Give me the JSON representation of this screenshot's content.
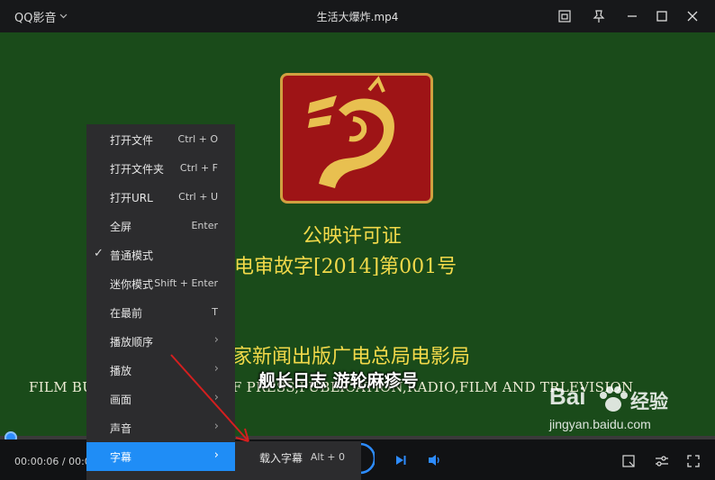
{
  "window": {
    "app_name": "QQ影音",
    "file_title": "生活大爆炸.mp4"
  },
  "video": {
    "certificate_title": "公映许可证",
    "certificate_number": "电审故字[2014]第001号",
    "bureau_cn": "家新闻出版广电总局电影局",
    "bureau_en": "FILM BU          STRATION OF PRESS,PUBLICATION,RADIO,FILM AND TRLEVISION",
    "subtitle": "舰长日志 游轮麻疹号"
  },
  "watermark": {
    "brand": "Bai",
    "brand_cn": "经验",
    "url": "jingyan.baidu.com"
  },
  "playback": {
    "time": "00:00:06 / 00:04",
    "progress_fraction": 0.01
  },
  "context_menu": {
    "items": [
      {
        "label": "打开文件",
        "shortcut": "Ctrl + O"
      },
      {
        "label": "打开文件夹",
        "shortcut": "Ctrl + F"
      },
      {
        "label": "打开URL",
        "shortcut": "Ctrl + U"
      },
      {
        "label": "全屏",
        "shortcut": "Enter"
      },
      {
        "label": "普通模式",
        "shortcut": "",
        "checked": true
      },
      {
        "label": "迷你模式",
        "shortcut": "Shift + Enter"
      },
      {
        "label": "在最前",
        "shortcut": "T"
      },
      {
        "label": "播放顺序",
        "submenu": true
      },
      {
        "label": "播放",
        "submenu": true
      },
      {
        "label": "画面",
        "submenu": true
      },
      {
        "label": "声音",
        "submenu": true
      },
      {
        "label": "字幕",
        "submenu": true,
        "active": true
      }
    ],
    "check_glyph": "✓",
    "arrow_glyph": "›"
  },
  "subtitle_submenu": {
    "items": [
      {
        "label": "载入字幕",
        "shortcut": "Alt + 0"
      }
    ]
  },
  "colors": {
    "accent": "#1f8df6",
    "video_bg": "#1a4b1a",
    "video_text": "#f2d94a",
    "annotation_arrow": "#d41f1f"
  },
  "icons": {
    "app_menu": "chevron-down-icon",
    "pip": "picture-in-picture-icon",
    "pin": "pin-icon",
    "minimize": "minimize-icon",
    "maximize": "maximize-icon",
    "close": "close-icon",
    "next": "next-track-icon",
    "volume": "volume-icon",
    "screenshot": "screenshot-icon",
    "settings": "settings-sliders-icon",
    "fullscreen": "fullscreen-icon"
  }
}
